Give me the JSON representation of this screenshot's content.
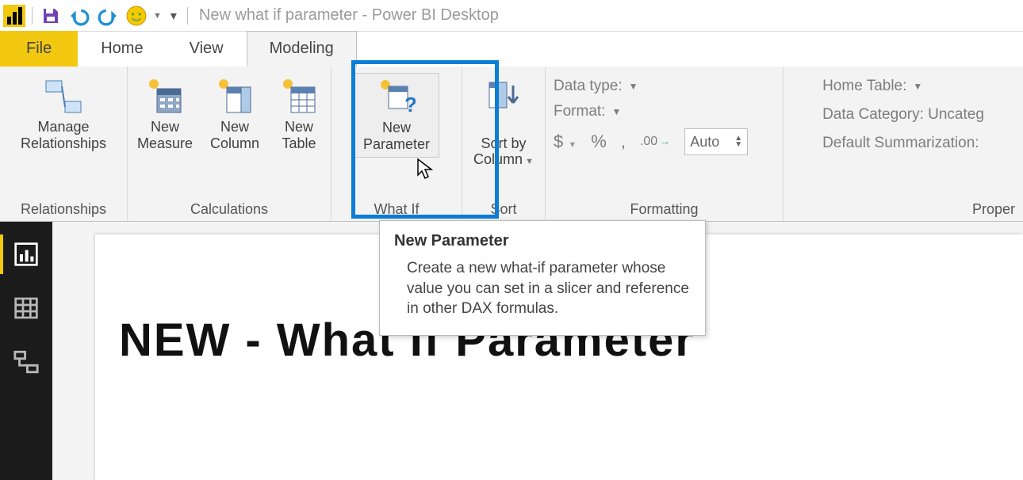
{
  "title": "New what if parameter - Power BI Desktop",
  "qat": {
    "save": "save-icon",
    "undo": "undo-icon",
    "redo": "redo-icon",
    "smiley": "feedback-icon",
    "dropdown": "qat-more-icon"
  },
  "tabs": {
    "file": "File",
    "home": "Home",
    "view": "View",
    "modeling": "Modeling"
  },
  "ribbon": {
    "relationships": {
      "label": "Relationships",
      "manage": "Manage\nRelationships"
    },
    "calculations": {
      "label": "Calculations",
      "newMeasure": "New\nMeasure",
      "newColumn": "New\nColumn",
      "newTable": "New\nTable"
    },
    "whatif": {
      "label": "What If",
      "newParameter": "New\nParameter"
    },
    "sort": {
      "label": "Sort",
      "sortBy": "Sort by\nColumn"
    },
    "formatting": {
      "label": "Formatting",
      "dataType": "Data type:",
      "format": "Format:",
      "currency": "$",
      "percent": "%",
      "comma": ",",
      "decimals": ".00",
      "decimalsArrow": "→",
      "auto": "Auto"
    },
    "properties": {
      "label": "Proper",
      "homeTable": "Home Table:",
      "dataCategory": "Data Category: Uncateg",
      "defaultSumm": "Default Summarization:"
    }
  },
  "tooltip": {
    "title": "New Parameter",
    "body": "Create a new what-if parameter whose value you can set in a slicer and reference in other DAX formulas."
  },
  "canvas": {
    "heading": "NEW -  What If Parameter"
  },
  "sidebar": {
    "report": "report-view",
    "data": "data-view",
    "model": "model-view"
  }
}
